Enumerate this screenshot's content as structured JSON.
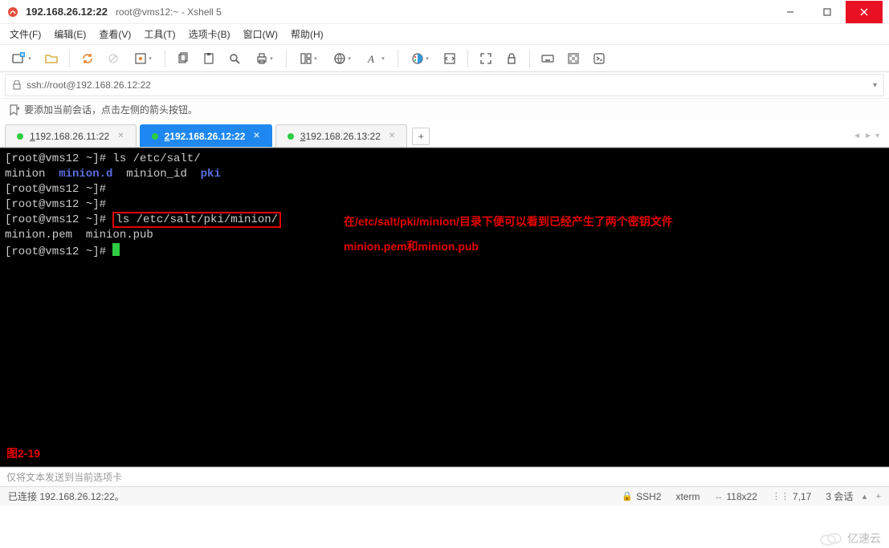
{
  "title": {
    "main": "192.168.26.12:22",
    "sub": "root@vms12:~ - Xshell 5"
  },
  "menu": {
    "file": "文件(F)",
    "edit": "编辑(E)",
    "view": "查看(V)",
    "tools": "工具(T)",
    "tabs": "选项卡(B)",
    "window": "窗口(W)",
    "help": "帮助(H)"
  },
  "address": "ssh://root@192.168.26.12:22",
  "hint": "要添加当前会话，点击左侧的箭头按钮。",
  "tabs": [
    {
      "num": "1",
      "label": " 192.168.26.11:22"
    },
    {
      "num": "2",
      "label": " 192.168.26.12:22"
    },
    {
      "num": "3",
      "label": " 192.168.26.13:22"
    }
  ],
  "addtab": "+",
  "term": {
    "l0p": "[root@vms12 ~]# ",
    "l0c": "ls /etc/salt/",
    "l1a": "minion  ",
    "l1b": "minion.d",
    "l1c": "  minion_id  ",
    "l1d": "pki",
    "l2": "[root@vms12 ~]#",
    "l3": "[root@vms12 ~]#",
    "l4p": "[root@vms12 ~]# ",
    "l4c": "ls /etc/salt/pki/minion/",
    "l5": "minion.pem  minion.pub",
    "l6": "[root@vms12 ~]# "
  },
  "annotation": {
    "l1": "在/etc/salt/pki/minion/目录下便可以看到已经产生了两个密钥文件",
    "l2": "minion.pem和minion.pub"
  },
  "figlabel": "图2-19",
  "sendhint": "仅将文本发送到当前选项卡",
  "status": {
    "conn": "已连接 192.168.26.12:22。",
    "ssh": "SSH2",
    "xterm": "xterm",
    "size": "118x22",
    "pos": "7,17",
    "sess": "3 会话"
  },
  "watermark": "亿速云"
}
